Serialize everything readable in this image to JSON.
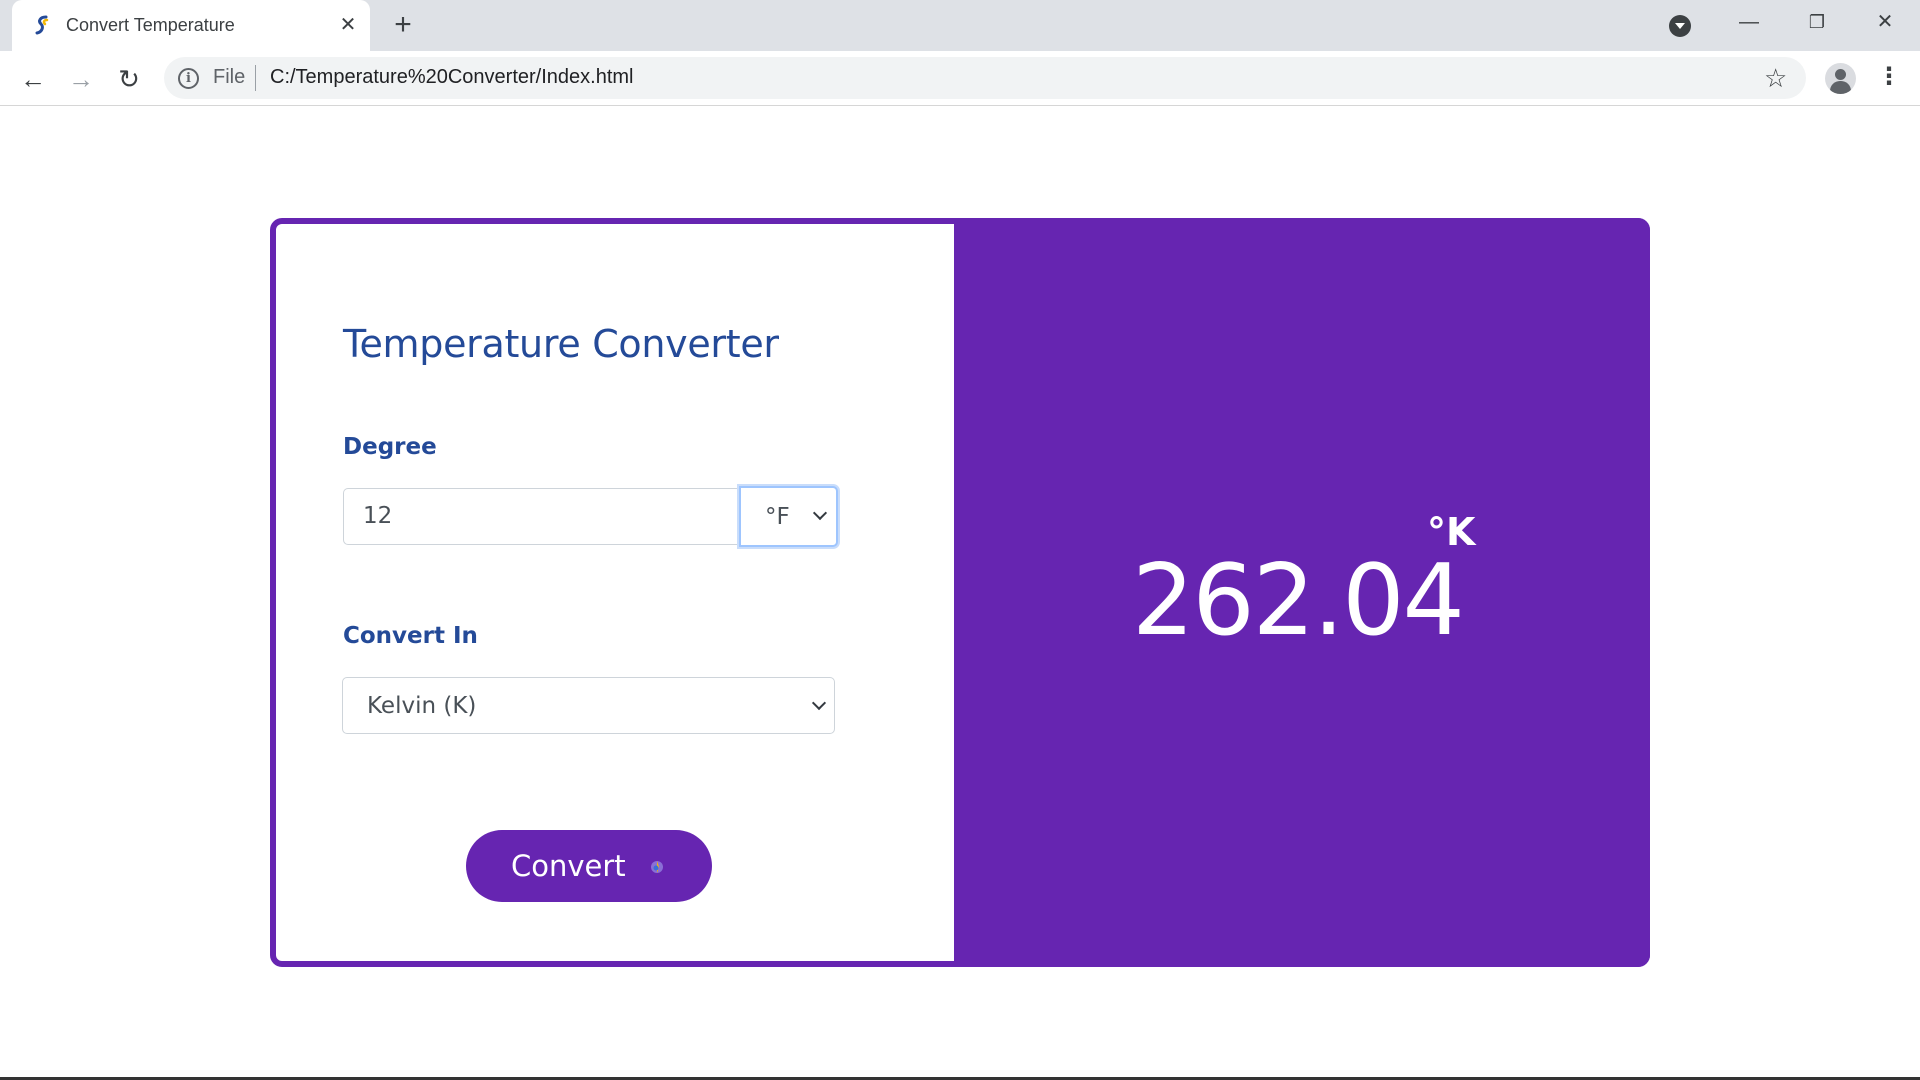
{
  "browser": {
    "tab_title": "Convert Temperature",
    "tab_close": "✕",
    "new_tab": "+",
    "scheme_label": "File",
    "url": "C:/Temperature%20Converter/Index.html",
    "window_controls": {
      "minimize": "—",
      "restore": "❐",
      "close": "✕"
    },
    "nav": {
      "back": "←",
      "forward": "→",
      "reload": "↻"
    },
    "star": "☆",
    "menu": "⋮",
    "info": "i"
  },
  "converter": {
    "title": "Temperature Converter",
    "degree_label": "Degree",
    "degree_value": "12",
    "from_unit": "°F",
    "convert_in_label": "Convert In",
    "convert_in_value": "Kelvin (K)",
    "button_label": "Convert"
  },
  "result": {
    "value": "262.04",
    "unit": "°K"
  },
  "colors": {
    "accent": "#6625b1",
    "heading": "#244a98",
    "chrome_bg": "#dee1e6"
  },
  "icons": {
    "favicon": "favicon-icon",
    "thermometer": "thermometer-icon"
  }
}
